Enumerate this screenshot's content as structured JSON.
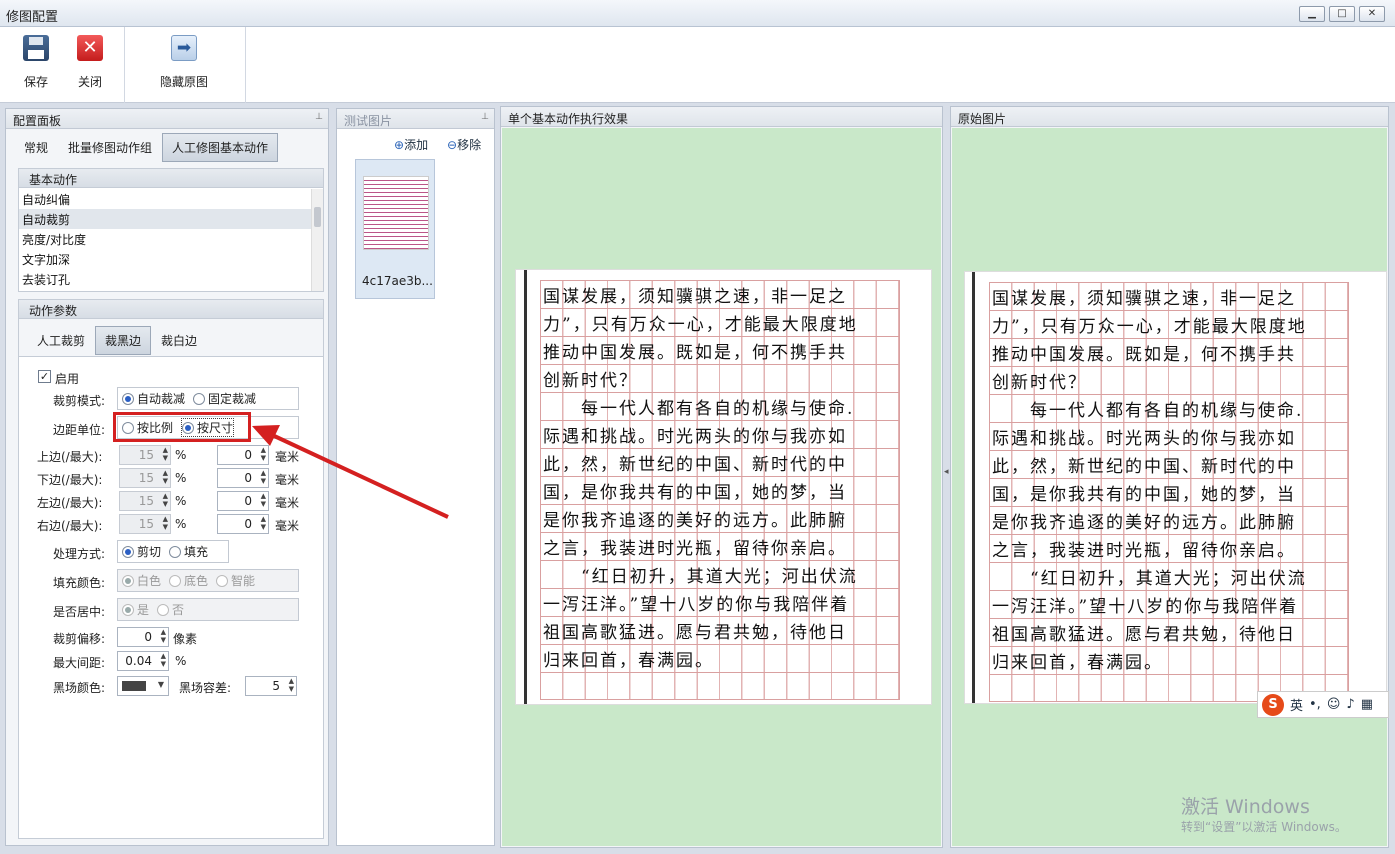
{
  "window": {
    "title": "修图配置"
  },
  "toolbar": {
    "save": "保存",
    "close": "关闭",
    "hide_original": "隐藏原图"
  },
  "config_panel": {
    "title": "配置面板",
    "tabs": [
      "常规",
      "批量修图动作组",
      "人工修图基本动作"
    ],
    "basic_actions": {
      "title": "基本动作",
      "items": [
        "自动纠偏",
        "自动裁剪",
        "亮度/对比度",
        "文字加深",
        "去装订孔"
      ]
    },
    "params": {
      "title": "动作参数",
      "tabs": [
        "人工裁剪",
        "裁黑边",
        "裁白边"
      ],
      "enable": "启用",
      "crop_mode_label": "裁剪模式:",
      "crop_mode_options": [
        "自动裁减",
        "固定裁减"
      ],
      "margin_unit_label": "边距单位:",
      "margin_unit_options": [
        "按比例",
        "按尺寸"
      ],
      "margins": [
        {
          "label": "上边(/最大):",
          "pct": "15",
          "pct_unit": "%",
          "mm": "0",
          "mm_unit": "毫米"
        },
        {
          "label": "下边(/最大):",
          "pct": "15",
          "pct_unit": "%",
          "mm": "0",
          "mm_unit": "毫米"
        },
        {
          "label": "左边(/最大):",
          "pct": "15",
          "pct_unit": "%",
          "mm": "0",
          "mm_unit": "毫米"
        },
        {
          "label": "右边(/最大):",
          "pct": "15",
          "pct_unit": "%",
          "mm": "0",
          "mm_unit": "毫米"
        }
      ],
      "process_label": "处理方式:",
      "process_options": [
        "剪切",
        "填充"
      ],
      "fill_color_label": "填充颜色:",
      "fill_color_options": [
        "白色",
        "底色",
        "智能"
      ],
      "center_label": "是否居中:",
      "center_options": [
        "是",
        "否"
      ],
      "offset_label": "裁剪偏移:",
      "offset_value": "0",
      "offset_unit": "像素",
      "max_gap_label": "最大间距:",
      "max_gap_value": "0.04",
      "max_gap_unit": "%",
      "black_color_label": "黑场颜色:",
      "black_color": "#444444",
      "black_tol_label": "黑场容差:",
      "black_tol_value": "5"
    }
  },
  "test_panel": {
    "title": "测试图片",
    "add": "添加",
    "remove": "移除",
    "thumb_name": "4c17ae3b..."
  },
  "effect_panel": {
    "title": "单个基本动作执行效果"
  },
  "original_panel": {
    "title": "原始图片"
  },
  "document_lines": [
    "国谋发展，须知骥骐之速，非一足之",
    "力”，只有万众一心，才能最大限度地",
    "推动中国发展。既如是，何不携手共",
    "创新时代？",
    "　　每一代人都有各自的机缘与使命.",
    "际遇和挑战。时光两头的你与我亦如",
    "此，然，新世纪的中国、新时代的中",
    "国，是你我共有的中国，她的梦，当",
    "是你我齐追逐的美好的远方。此肺腑",
    "之言，我装进时光瓶，留待你亲启。",
    "　　“红日初升，其道大光；河出伏流",
    "一泻汪洋。”望十八岁的你与我陪伴着",
    "祖国高歌猛进。愿与君共勉，待他日",
    "归来回首，春满园。",
    ""
  ],
  "ime": {
    "lang": "英"
  },
  "watermark": {
    "line1": "激活 Windows",
    "line2": "转到“设置”以激活 Windows。"
  },
  "colors": {
    "highlight": "#d42020",
    "view_bg": "#c9e8c9"
  }
}
